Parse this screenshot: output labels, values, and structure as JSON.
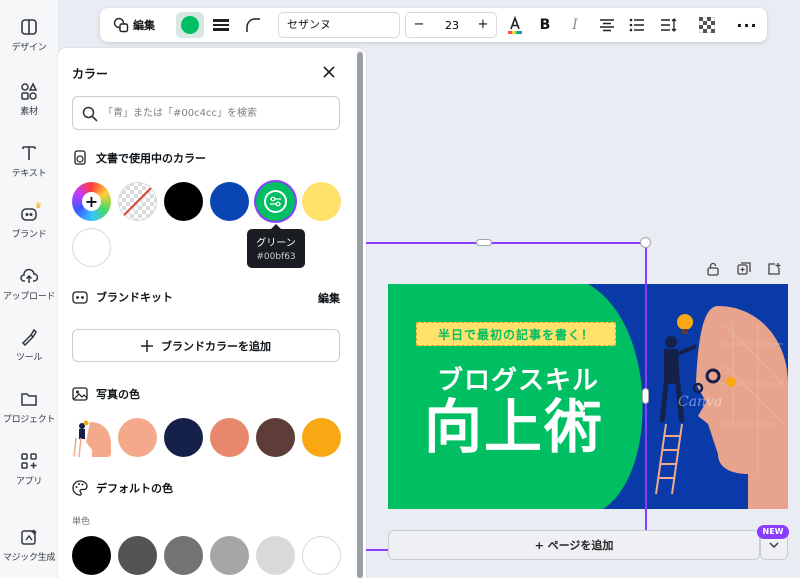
{
  "sidebar": {
    "items": [
      {
        "label": "デザイン",
        "icon": "design-icon"
      },
      {
        "label": "素材",
        "icon": "elements-icon"
      },
      {
        "label": "テキスト",
        "icon": "text-icon"
      },
      {
        "label": "ブランド",
        "icon": "brand-icon"
      },
      {
        "label": "アップロード",
        "icon": "upload-icon"
      },
      {
        "label": "ツール",
        "icon": "tools-icon"
      },
      {
        "label": "プロジェクト",
        "icon": "folder-icon"
      },
      {
        "label": "アプリ",
        "icon": "apps-icon"
      },
      {
        "label": "マジック生成",
        "icon": "magic-icon"
      }
    ]
  },
  "toolbar": {
    "edit_label": "編集",
    "text_color": "#00bf63",
    "font_name": "セザンヌ",
    "font_size": "23",
    "minus": "−",
    "plus": "+",
    "bold": "B",
    "italic": "I"
  },
  "color_panel": {
    "title": "カラー",
    "search_placeholder": "「青」または「#00c4cc」を検索",
    "document_colors": {
      "title": "文書で使用中のカラー",
      "swatches": [
        "#000000",
        "#0a46b3",
        "#00bf63",
        "#ffe16b",
        "#ffffff"
      ]
    },
    "tooltip": {
      "name": "グリーン",
      "hex": "#00bf63"
    },
    "brand_kit": {
      "title": "ブランドキット",
      "edit": "編集",
      "add_button": "ブランドカラーを追加"
    },
    "photo_colors": {
      "title": "写真の色",
      "swatches": [
        "#f3a98a",
        "#152149",
        "#e8876b",
        "#5e3c38",
        "#f9a814"
      ]
    },
    "default_colors": {
      "title": "デフォルトの色",
      "subtitle": "単色",
      "swatches": [
        "#000000",
        "#545454",
        "#737373",
        "#a6a6a6",
        "#d9d9d9",
        "#ffffff"
      ]
    }
  },
  "design": {
    "banner_text": "半日で最初の記事を書く！",
    "headline": "ブログスキル",
    "title": "向上術",
    "watermark": "Canva",
    "green_color": "#00bf63",
    "blue_color": "#0a3aa8"
  },
  "add_page": {
    "label": "+ ページを追加",
    "badge": "NEW"
  }
}
